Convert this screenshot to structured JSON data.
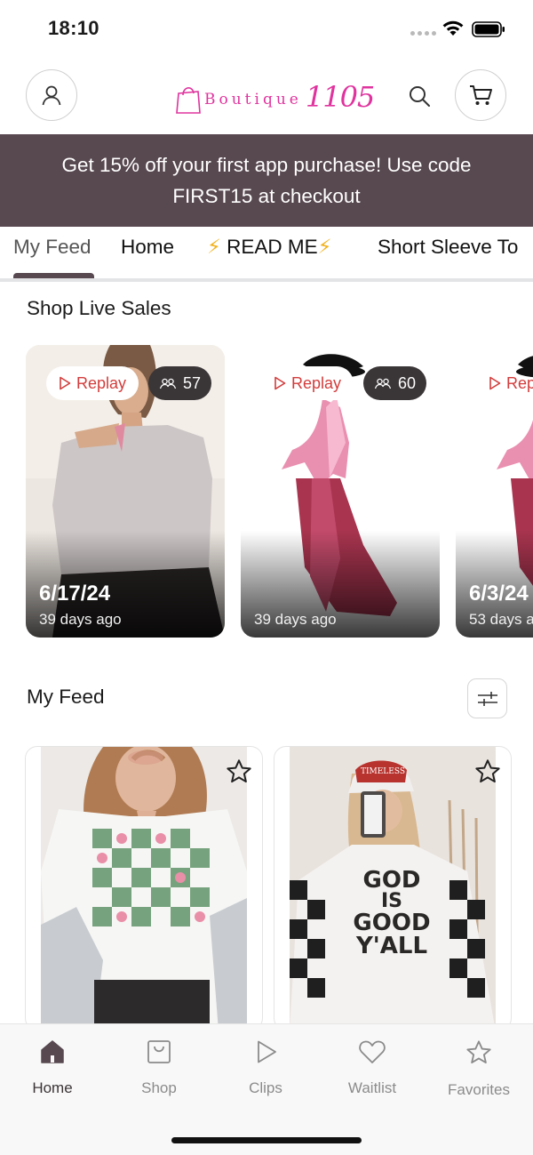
{
  "status_bar": {
    "time": "18:10"
  },
  "header": {
    "logo_word": "Boutique",
    "logo_number": "1105",
    "brand_color": "#e0339e",
    "icons": [
      "account-icon",
      "search-icon",
      "cart-icon"
    ]
  },
  "promo": {
    "text": "Get 15% off your first app purchase!  Use code FIRST15 at checkout",
    "background": "#584850"
  },
  "tabs": {
    "items": [
      {
        "label": "My Feed",
        "active": true
      },
      {
        "label": "Home"
      },
      {
        "label": "READ ME",
        "prefix": "⚡",
        "suffix": "⚡"
      },
      {
        "label": "Short Sleeve To"
      }
    ]
  },
  "live_sales": {
    "title": "Shop Live Sales",
    "cards": [
      {
        "replay": "Replay",
        "viewers": "57",
        "date": "6/17/24",
        "ago": "39 days ago"
      },
      {
        "replay": "Replay",
        "viewers": "60",
        "date": "",
        "ago": "39 days ago"
      },
      {
        "replay": "Rep",
        "date": "6/3/24",
        "ago": "53 days a"
      }
    ]
  },
  "feed": {
    "title": "My Feed",
    "products": [
      {
        "name": "western-graphic-tee",
        "starred": false
      },
      {
        "name": "god-is-good-yall-tee",
        "starred": false,
        "art_text": [
          "GOD",
          "IS",
          "GOOD",
          "Y'ALL"
        ],
        "hat_text": "TIMELESS"
      }
    ]
  },
  "bottom_nav": {
    "items": [
      {
        "label": "Home",
        "active": true
      },
      {
        "label": "Shop"
      },
      {
        "label": "Clips"
      },
      {
        "label": "Waitlist"
      },
      {
        "label": "Favorites"
      }
    ]
  }
}
